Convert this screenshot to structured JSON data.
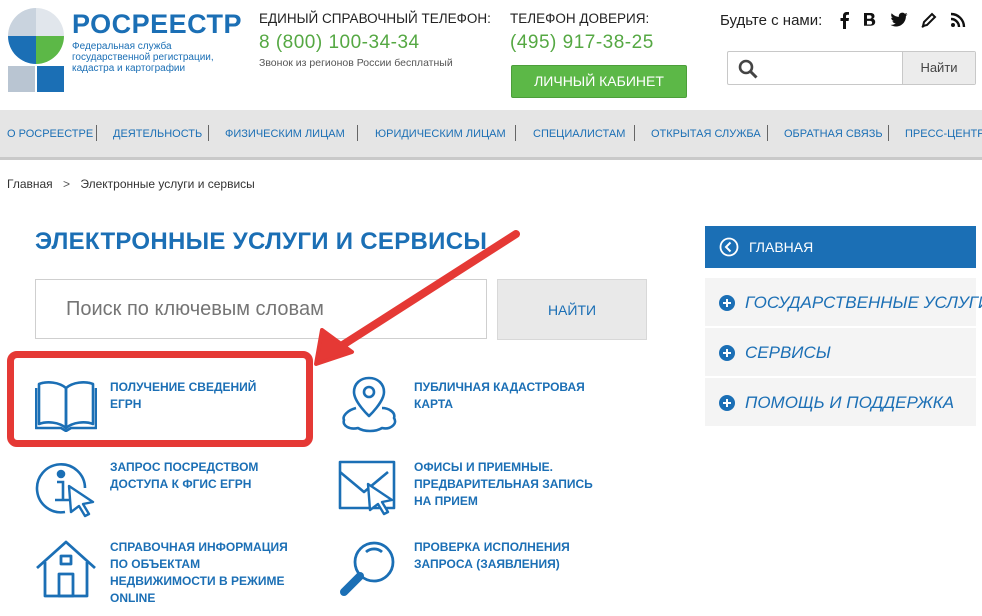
{
  "header": {
    "brand_title": "РОСРЕЕСТР",
    "brand_subtitle": "Федеральная служба государственной регистрации, кадастра и картографии",
    "phone1_caption": "ЕДИНЫЙ СПРАВОЧНЫЙ ТЕЛЕФОН:",
    "phone1_number": "8 (800) 100-34-34",
    "phone1_note": "Звонок из регионов России бесплатный",
    "phone2_caption": "ТЕЛЕФОН ДОВЕРИЯ:",
    "phone2_number": "(495) 917-38-25",
    "cabinet_button": "ЛИЧНЫЙ КАБИНЕТ",
    "social_label": "Будьте с нами:",
    "social_icons": [
      "facebook-icon",
      "vk-icon",
      "twitter-icon",
      "blog-icon",
      "rss-icon"
    ],
    "search_placeholder": "",
    "search_button": "Найти"
  },
  "nav": {
    "items": [
      "О РОСРЕЕСТРЕ",
      "ДЕЯТЕЛЬНОСТЬ",
      "ФИЗИЧЕСКИМ ЛИЦАМ",
      "ЮРИДИЧЕСКИМ ЛИЦАМ",
      "СПЕЦИАЛИСТАМ",
      "ОТКРЫТАЯ СЛУЖБА",
      "ОБРАТНАЯ СВЯЗЬ",
      "ПРЕСС-ЦЕНТР"
    ]
  },
  "breadcrumb": {
    "home": "Главная",
    "separator": ">",
    "current": "Электронные услуги и сервисы"
  },
  "main": {
    "title": "ЭЛЕКТРОННЫЕ УСЛУГИ И СЕРВИСЫ",
    "keyword_placeholder": "Поиск по ключевым словам",
    "keyword_button": "НАЙТИ",
    "services": [
      {
        "label": "ПОЛУЧЕНИЕ СВЕДЕНИЙ ЕГРН",
        "icon": "book-icon"
      },
      {
        "label": "ПУБЛИЧНАЯ КАДАСТРОВАЯ КАРТА",
        "icon": "map-pin-icon"
      },
      {
        "label": "ЗАПРОС ПОСРЕДСТВОМ ДОСТУПА К ФГИС ЕГРН",
        "icon": "info-cursor-icon"
      },
      {
        "label": "ОФИСЫ И ПРИЕМНЫЕ. ПРЕДВАРИТЕЛЬНАЯ ЗАПИСЬ НА ПРИЕМ",
        "icon": "envelope-cursor-icon"
      },
      {
        "label": "СПРАВОЧНАЯ ИНФОРМАЦИЯ ПО ОБЪЕКТАМ НЕДВИЖИМОСТИ В РЕЖИМЕ ONLINE",
        "icon": "house-icon"
      },
      {
        "label": "ПРОВЕРКА ИСПОЛНЕНИЯ ЗАПРОСА (ЗАЯВЛЕНИЯ)",
        "icon": "magnifier-icon"
      }
    ],
    "highlight_color": "#e53935"
  },
  "sidebar": {
    "head": "ГЛАВНАЯ",
    "items": [
      "ГОСУДАРСТВЕННЫЕ УСЛУГИ",
      "СЕРВИСЫ",
      "ПОМОЩЬ И ПОДДЕРЖКА"
    ]
  },
  "colors": {
    "brand_blue": "#1b6fb5",
    "green": "#5cb847",
    "nav_bg": "#e5e5e5",
    "highlight": "#e53935"
  }
}
